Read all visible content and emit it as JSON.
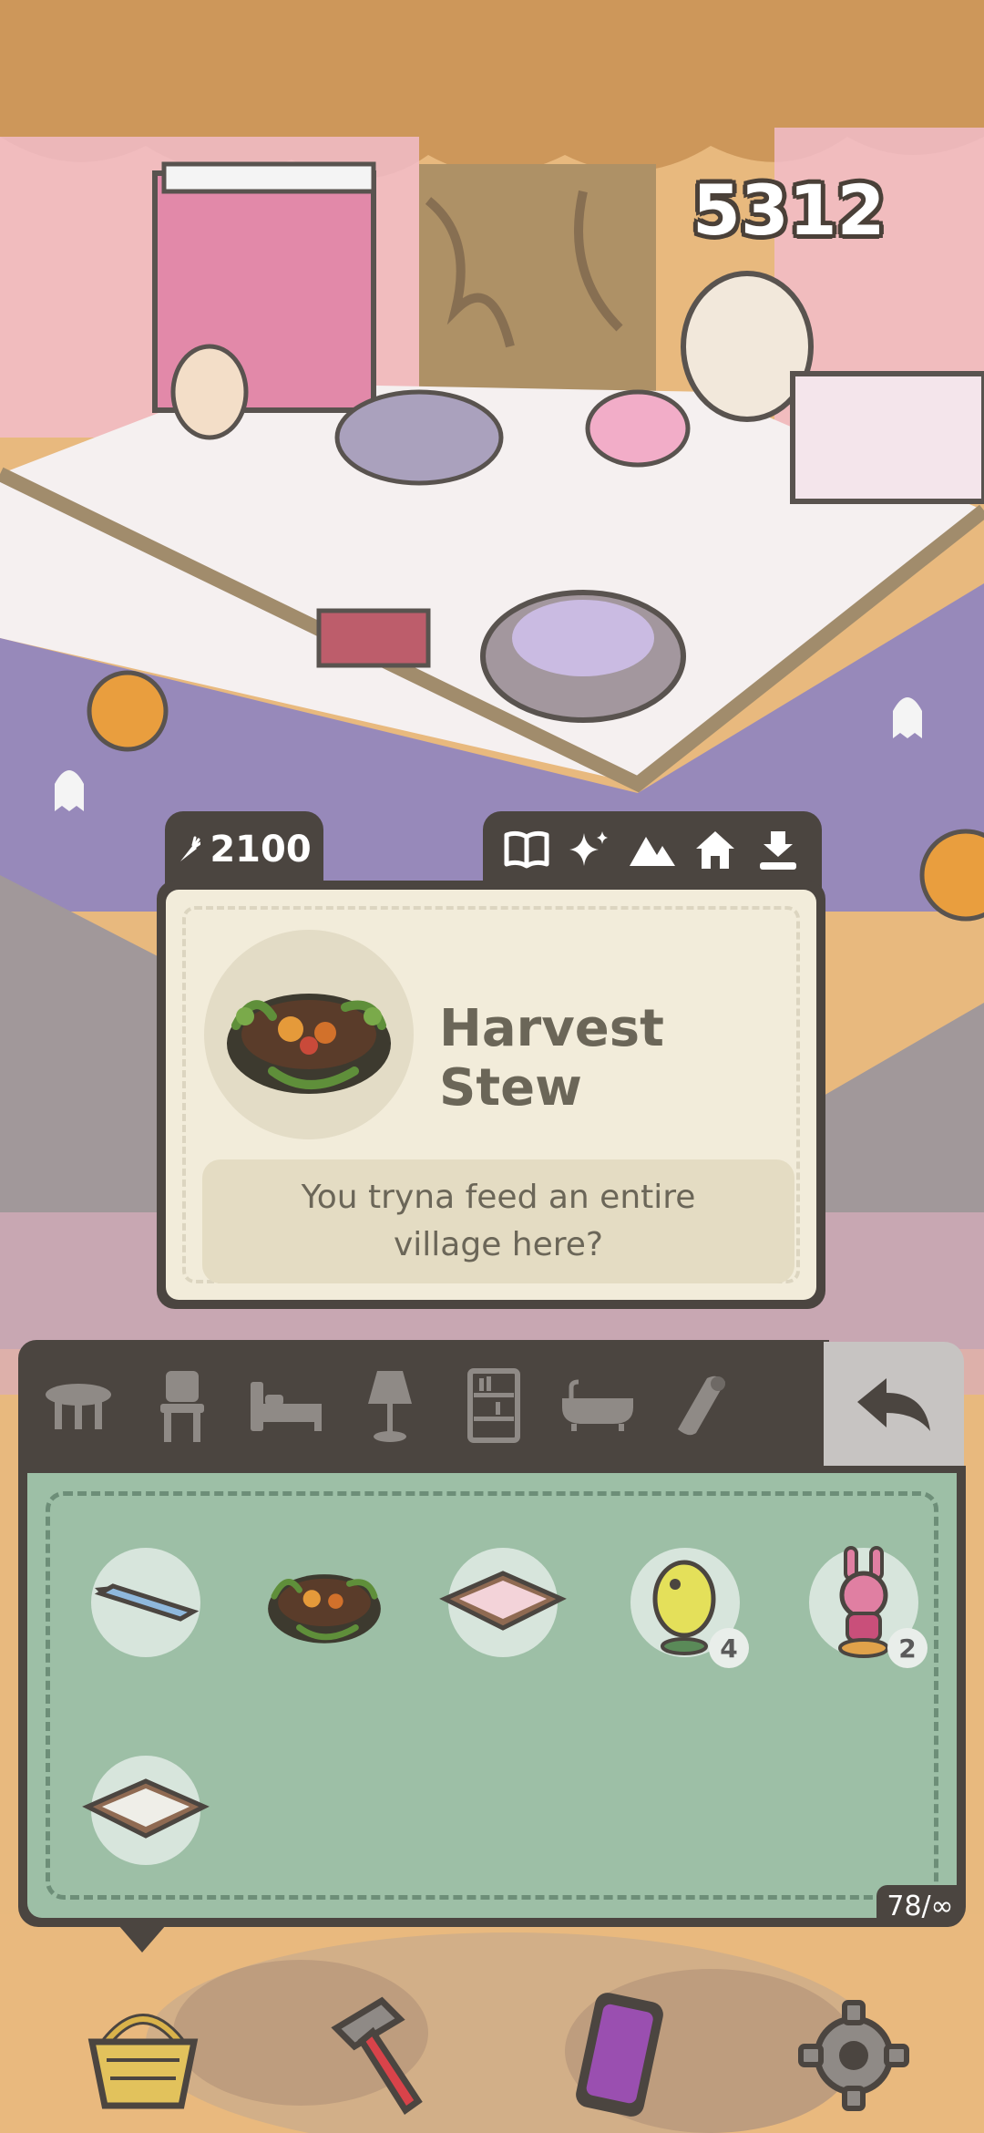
{
  "hud": {
    "score": "5312"
  },
  "selected_item": {
    "price": "2100",
    "price_icon": "carrot-icon",
    "title": "Harvest Stew",
    "description": "You tryna feed an entire village here?",
    "actions": [
      "book-icon",
      "sparkle-icon",
      "mountains-icon",
      "home-icon",
      "download-icon"
    ]
  },
  "categories": [
    {
      "name": "table",
      "icon": "table-icon"
    },
    {
      "name": "chair",
      "icon": "chair-icon"
    },
    {
      "name": "bed",
      "icon": "bed-icon"
    },
    {
      "name": "lamp",
      "icon": "lamp-icon"
    },
    {
      "name": "shelf",
      "icon": "bookshelf-icon"
    },
    {
      "name": "bathtub",
      "icon": "bathtub-icon"
    },
    {
      "name": "rug",
      "icon": "rug-icon"
    }
  ],
  "back_icon": "back-arrow-icon",
  "inventory": {
    "items": [
      {
        "name": "blue-pen",
        "count": ""
      },
      {
        "name": "harvest-stew",
        "count": ""
      },
      {
        "name": "pink-tray",
        "count": ""
      },
      {
        "name": "yellow-fish-figure",
        "count": "4"
      },
      {
        "name": "pink-bunny-figure",
        "count": "2"
      },
      {
        "name": "white-tray",
        "count": ""
      }
    ],
    "capacity": "78/∞"
  },
  "bottom_nav": [
    {
      "name": "basket",
      "icon": "basket-icon"
    },
    {
      "name": "build",
      "icon": "hammer-icon"
    },
    {
      "name": "phone",
      "icon": "phone-icon"
    },
    {
      "name": "settings",
      "icon": "gear-icon"
    }
  ],
  "colors": {
    "panel_dark": "#4b4540",
    "card_bg": "#f2ecda",
    "inventory_bg": "#9dbfa6",
    "title_text": "#6b6658"
  }
}
